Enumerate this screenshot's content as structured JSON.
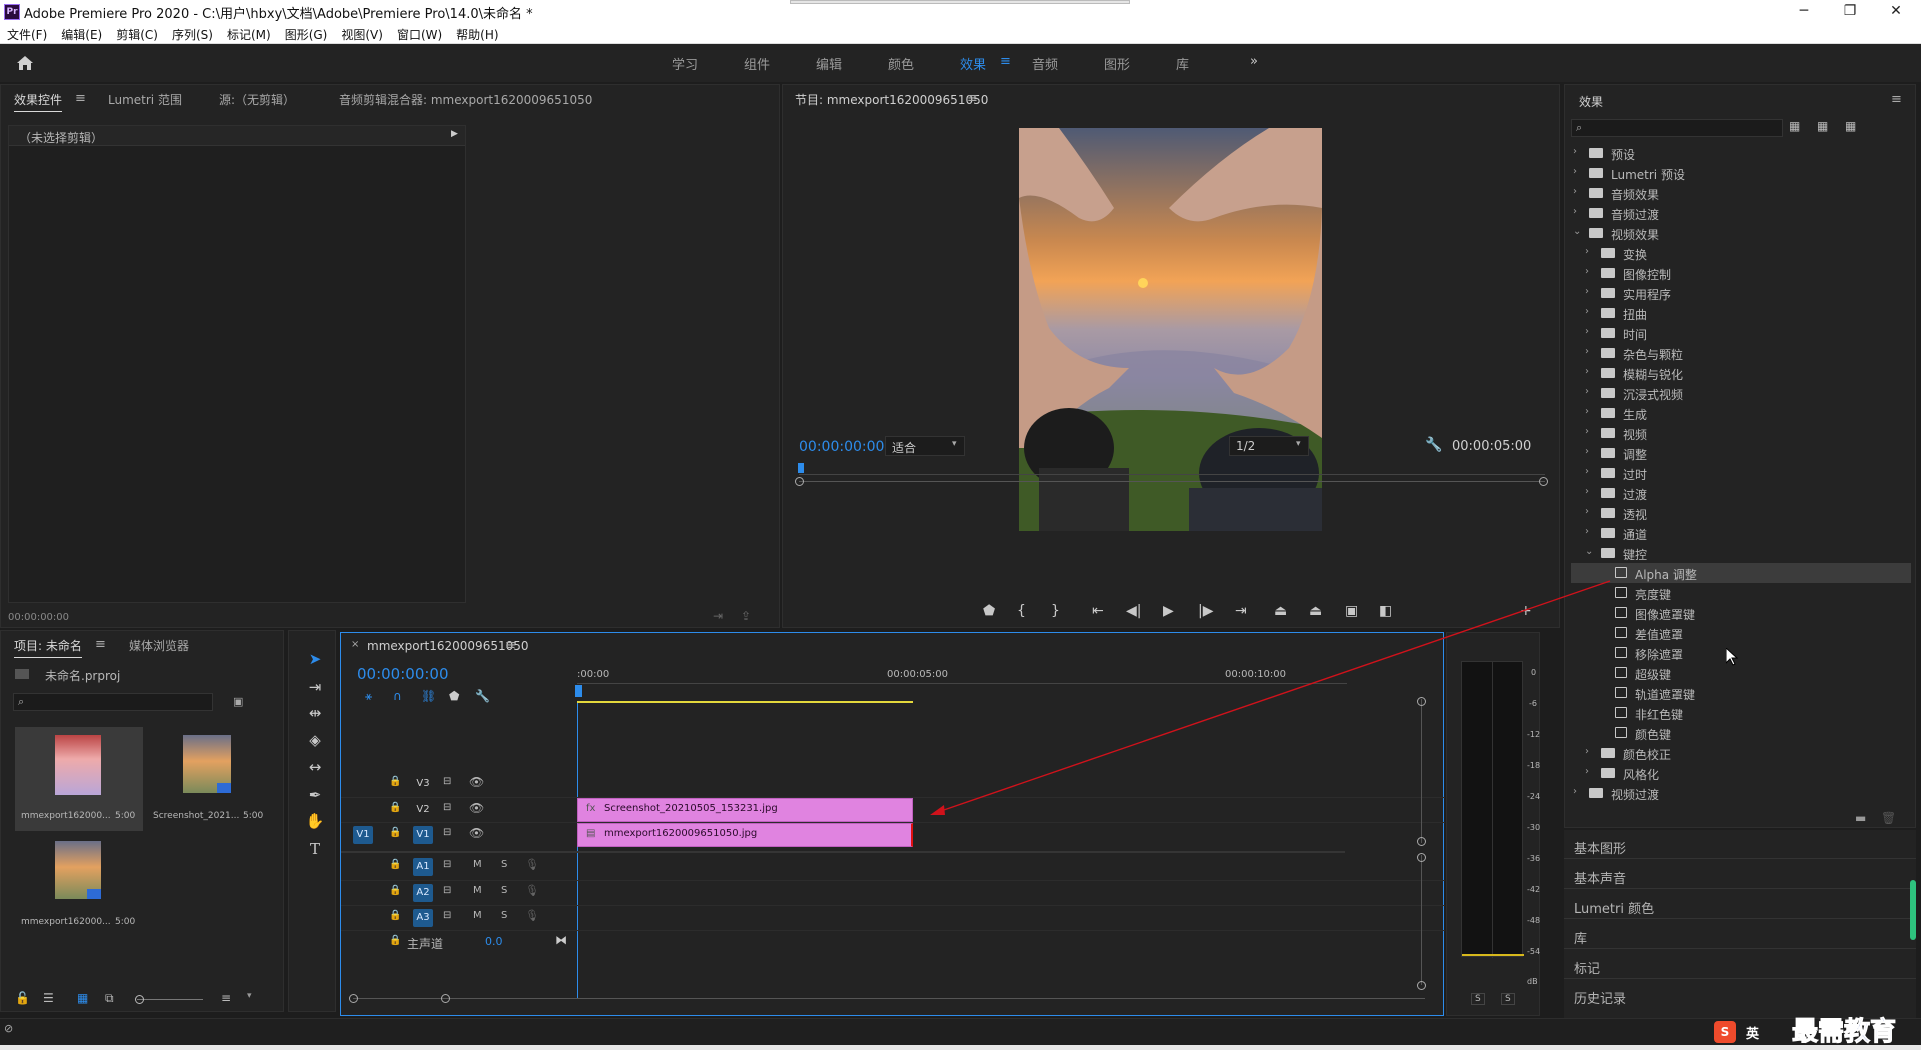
{
  "window": {
    "title": "Adobe Premiere Pro 2020 - C:\\用户\\hbxy\\文档\\Adobe\\Premiere Pro\\14.0\\未命名 *",
    "app_icon": "Pr",
    "minimize": "─",
    "maximize": "❐",
    "close": "✕"
  },
  "menu": [
    "文件(F)",
    "编辑(E)",
    "剪辑(C)",
    "序列(S)",
    "标记(M)",
    "图形(G)",
    "视图(V)",
    "窗口(W)",
    "帮助(H)"
  ],
  "workspaces": {
    "items": [
      "学习",
      "组件",
      "编辑",
      "颜色",
      "效果",
      "音频",
      "图形",
      "库"
    ],
    "active": "效果",
    "more": "»"
  },
  "source_panel": {
    "tabs": [
      "效果控件",
      "Lumetri 范围",
      "源:（无剪辑）",
      "音频剪辑混合器: mmexport1620009651050"
    ],
    "no_clip": "（未选择剪辑）",
    "timecode": "00:00:00:00"
  },
  "program_monitor": {
    "title": "节目: mmexport1620009651050",
    "timecode_current": "00:00:00:00",
    "fit": "适合",
    "resolution": "1/2",
    "timecode_duration": "00:00:05:00"
  },
  "project_panel": {
    "tabs": [
      "项目: 未命名",
      "媒体浏览器"
    ],
    "project_file": "未命名.prproj",
    "items": [
      {
        "name": "mmexport162000...",
        "duration": "5:00"
      },
      {
        "name": "Screenshot_2021...",
        "duration": "5:00"
      },
      {
        "name": "mmexport162000...",
        "duration": "5:00"
      }
    ]
  },
  "timeline": {
    "sequence_name": "mmexport1620009651050",
    "timecode": "00:00:00:00",
    "ruler": [
      ":00:00",
      "00:00:05:00",
      "00:00:10:00"
    ],
    "video_tracks": [
      "V3",
      "V2",
      "V1"
    ],
    "audio_tracks": [
      "A1",
      "A2",
      "A3"
    ],
    "source_patch": "V1",
    "mute": "M",
    "solo": "S",
    "master_label": "主声道",
    "master_value": "0.0",
    "clips": {
      "v2": "Screenshot_20210505_153231.jpg",
      "v1": "mmexport1620009651050.jpg"
    }
  },
  "audio_meter": {
    "scale": [
      "0",
      "-6",
      "-12",
      "-18",
      "-24",
      "-30",
      "-36",
      "-42",
      "-48",
      "-54",
      "dB"
    ],
    "solo_left": "S",
    "solo_right": "S"
  },
  "effects_panel": {
    "title": "效果",
    "tree": [
      {
        "label": "预设",
        "level": 0,
        "expanded": false,
        "type": "special"
      },
      {
        "label": "Lumetri 预设",
        "level": 0,
        "expanded": false,
        "type": "special"
      },
      {
        "label": "音频效果",
        "level": 0,
        "expanded": false,
        "type": "folder"
      },
      {
        "label": "音频过渡",
        "level": 0,
        "expanded": false,
        "type": "folder"
      },
      {
        "label": "视频效果",
        "level": 0,
        "expanded": true,
        "type": "folder"
      },
      {
        "label": "变换",
        "level": 1,
        "expanded": false,
        "type": "folder"
      },
      {
        "label": "图像控制",
        "level": 1,
        "expanded": false,
        "type": "folder"
      },
      {
        "label": "实用程序",
        "level": 1,
        "expanded": false,
        "type": "folder"
      },
      {
        "label": "扭曲",
        "level": 1,
        "expanded": false,
        "type": "folder"
      },
      {
        "label": "时间",
        "level": 1,
        "expanded": false,
        "type": "folder"
      },
      {
        "label": "杂色与颗粒",
        "level": 1,
        "expanded": false,
        "type": "folder"
      },
      {
        "label": "模糊与锐化",
        "level": 1,
        "expanded": false,
        "type": "folder"
      },
      {
        "label": "沉浸式视频",
        "level": 1,
        "expanded": false,
        "type": "folder"
      },
      {
        "label": "生成",
        "level": 1,
        "expanded": false,
        "type": "folder"
      },
      {
        "label": "视频",
        "level": 1,
        "expanded": false,
        "type": "folder"
      },
      {
        "label": "调整",
        "level": 1,
        "expanded": false,
        "type": "folder"
      },
      {
        "label": "过时",
        "level": 1,
        "expanded": false,
        "type": "folder"
      },
      {
        "label": "过渡",
        "level": 1,
        "expanded": false,
        "type": "folder"
      },
      {
        "label": "透视",
        "level": 1,
        "expanded": false,
        "type": "folder"
      },
      {
        "label": "通道",
        "level": 1,
        "expanded": false,
        "type": "folder"
      },
      {
        "label": "键控",
        "level": 1,
        "expanded": true,
        "type": "folder"
      },
      {
        "label": "Alpha 调整",
        "level": 2,
        "type": "effect",
        "selected": true
      },
      {
        "label": "亮度键",
        "level": 2,
        "type": "effect"
      },
      {
        "label": "图像遮罩键",
        "level": 2,
        "type": "effect"
      },
      {
        "label": "差值遮罩",
        "level": 2,
        "type": "effect"
      },
      {
        "label": "移除遮罩",
        "level": 2,
        "type": "effect"
      },
      {
        "label": "超级键",
        "level": 2,
        "type": "effect"
      },
      {
        "label": "轨道遮罩键",
        "level": 2,
        "type": "effect"
      },
      {
        "label": "非红色键",
        "level": 2,
        "type": "effect"
      },
      {
        "label": "颜色键",
        "level": 2,
        "type": "effect"
      },
      {
        "label": "颜色校正",
        "level": 1,
        "expanded": false,
        "type": "folder"
      },
      {
        "label": "风格化",
        "level": 1,
        "expanded": false,
        "type": "folder"
      },
      {
        "label": "视频过渡",
        "level": 0,
        "expanded": false,
        "type": "folder"
      }
    ],
    "sections": [
      "基本图形",
      "基本声音",
      "Lumetri 颜色",
      "库",
      "标记",
      "历史记录"
    ]
  },
  "taskbar": {
    "ime_label": "英",
    "watermark": "最需教育"
  },
  "colors": {
    "accent": "#2d8ceb",
    "clip_pink": "#e083e0",
    "arrow": "#d0121b"
  }
}
